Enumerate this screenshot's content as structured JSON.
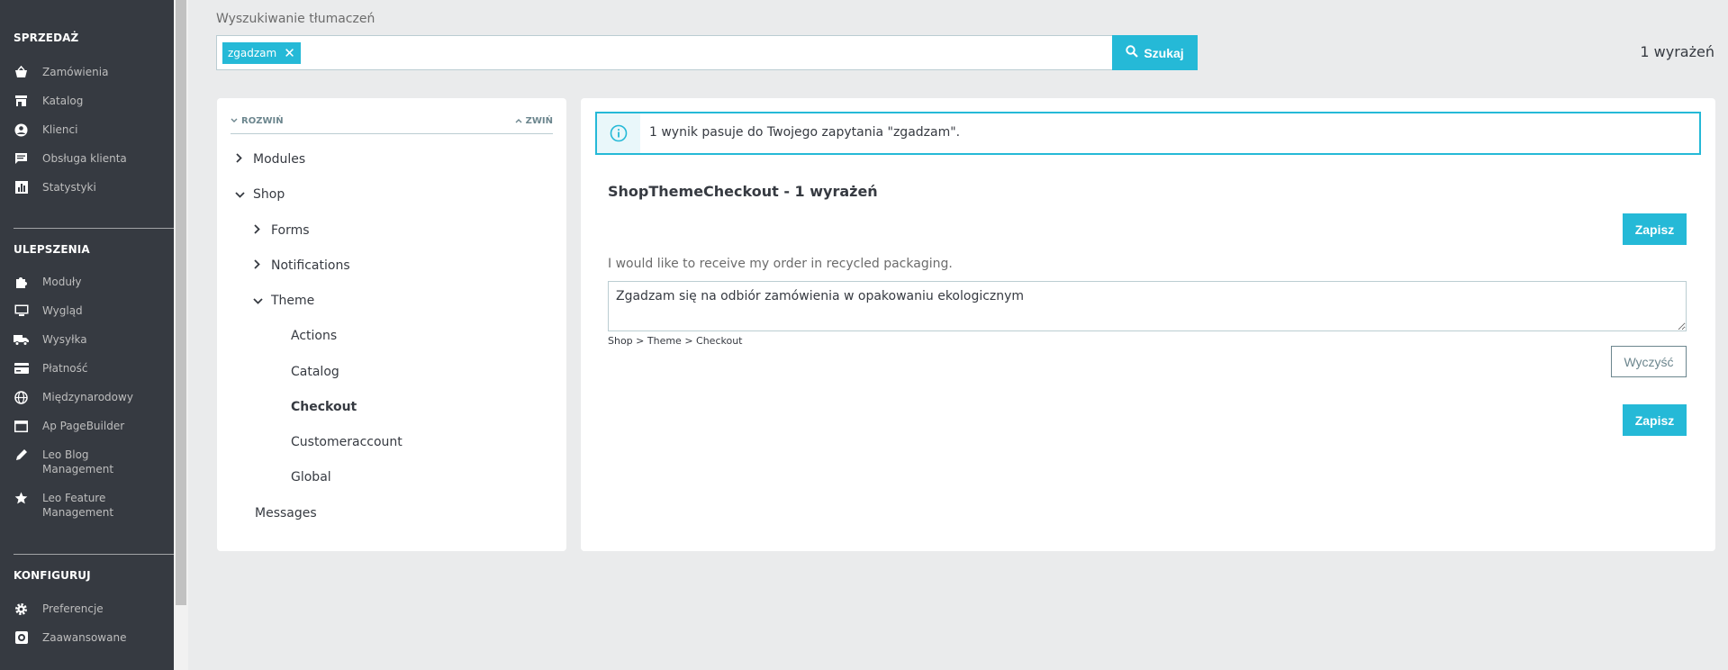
{
  "sidebar": {
    "sections": [
      {
        "title": "SPRZEDAŻ",
        "items": [
          {
            "label": "Zamówienia",
            "icon": "basket-icon"
          },
          {
            "label": "Katalog",
            "icon": "store-icon"
          },
          {
            "label": "Klienci",
            "icon": "user-circle-icon"
          },
          {
            "label": "Obsługa klienta",
            "icon": "chat-icon"
          },
          {
            "label": "Statystyki",
            "icon": "bar-chart-icon"
          }
        ]
      },
      {
        "title": "ULEPSZENIA",
        "items": [
          {
            "label": "Moduły",
            "icon": "puzzle-icon"
          },
          {
            "label": "Wygląd",
            "icon": "monitor-icon"
          },
          {
            "label": "Wysyłka",
            "icon": "truck-icon"
          },
          {
            "label": "Płatność",
            "icon": "credit-card-icon"
          },
          {
            "label": "Międzynarodowy",
            "icon": "globe-icon"
          },
          {
            "label": "Ap PageBuilder",
            "icon": "window-icon"
          },
          {
            "label": "Leo Blog Management",
            "icon": "pencil-icon"
          },
          {
            "label": "Leo Feature Management",
            "icon": "star-icon"
          }
        ]
      },
      {
        "title": "KONFIGURUJ",
        "items": [
          {
            "label": "Preferencje",
            "icon": "gear-icon"
          },
          {
            "label": "Zaawansowane",
            "icon": "settings-box-icon"
          }
        ]
      }
    ]
  },
  "search": {
    "title": "Wyszukiwanie tłumaczeń",
    "tag": "zgadzam",
    "button_label": "Szukaj",
    "count": "1 wyrażeń"
  },
  "tree": {
    "expand_label": "ROZWIŃ",
    "collapse_label": "ZWIŃ",
    "nodes": [
      {
        "label": "Modules",
        "state": "collapsed"
      },
      {
        "label": "Shop",
        "state": "expanded"
      },
      {
        "label": "Forms",
        "state": "collapsed"
      },
      {
        "label": "Notifications",
        "state": "collapsed"
      },
      {
        "label": "Theme",
        "state": "expanded"
      },
      {
        "label": "Actions",
        "state": "leaf"
      },
      {
        "label": "Catalog",
        "state": "leaf"
      },
      {
        "label": "Checkout",
        "state": "selected"
      },
      {
        "label": "Customeraccount",
        "state": "leaf"
      },
      {
        "label": "Global",
        "state": "leaf"
      },
      {
        "label": "Messages",
        "state": "leaf"
      }
    ]
  },
  "results": {
    "alert": "1 wynik pasuje do Twojego zapytania \"zgadzam\".",
    "domain_title": "ShopThemeCheckout - 1 wyrażeń",
    "save_label": "Zapisz",
    "original": "I would like to receive my order in recycled packaging.",
    "translation": "Zgadzam się na odbiór zamówienia w opakowaniu ekologicznym",
    "breadcrumb": "Shop > Theme > Checkout",
    "reset_label": "Wyczyść"
  },
  "colors": {
    "accent": "#25b9d7",
    "sidebar_bg": "#363a41",
    "page_bg": "#eaebec"
  }
}
